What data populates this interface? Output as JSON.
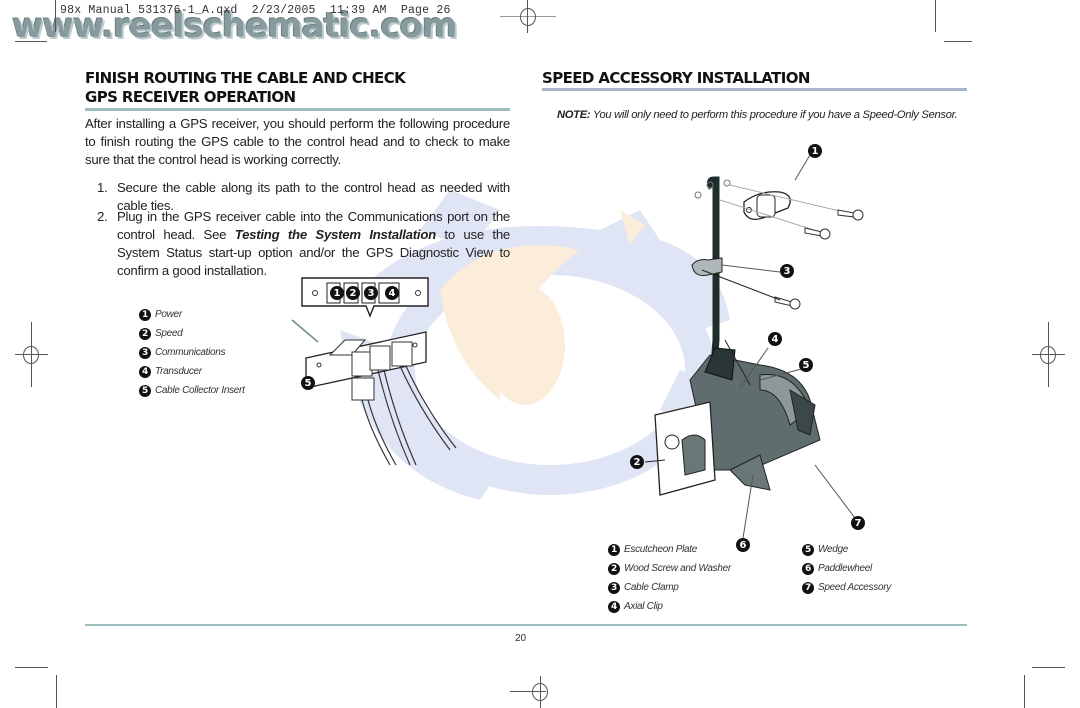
{
  "slug": "98x Manual 531376-1_A.qxd  2/23/2005  11:39 AM  Page 26",
  "watermark": "www.reelschematic.com",
  "left": {
    "heading_line1": "FINISH ROUTING THE CABLE AND CHECK",
    "heading_line2": "GPS RECEIVER OPERATION",
    "intro": "After installing a GPS receiver, you should perform the following procedure to finish routing the GPS cable to the control head and to check to make sure that the control head is working correctly.",
    "steps": [
      {
        "num": "1.",
        "text": "Secure the cable along its path to the control head as needed with cable ties."
      },
      {
        "num": "2.",
        "text_before": "Plug in the GPS receiver cable into the Communications port on the control head. See ",
        "emphasis": "Testing the System Installation",
        "text_after": " to use the System Status start-up option and/or the GPS Diagnostic View to confirm a good installation."
      }
    ],
    "figure_legend": [
      {
        "num": "1",
        "label": "Power"
      },
      {
        "num": "2",
        "label": "Speed"
      },
      {
        "num": "3",
        "label": "Communications"
      },
      {
        "num": "4",
        "label": "Transducer"
      },
      {
        "num": "5",
        "label": "Cable Collector Insert"
      }
    ],
    "port_numbers": [
      "1",
      "2",
      "3",
      "4"
    ],
    "callout_5": "5"
  },
  "right": {
    "heading": "SPEED ACCESSORY INSTALLATION",
    "note_label": "NOTE:",
    "note_text": " You will only need to perform this procedure if you have a Speed-Only Sensor.",
    "callouts": [
      "1",
      "2",
      "3",
      "4",
      "5",
      "6",
      "7"
    ],
    "legend_col1": [
      {
        "num": "1",
        "label": "Escutcheon Plate"
      },
      {
        "num": "2",
        "label": "Wood Screw and Washer"
      },
      {
        "num": "3",
        "label": "Cable Clamp"
      },
      {
        "num": "4",
        "label": "Axial Clip"
      }
    ],
    "legend_col2": [
      {
        "num": "5",
        "label": "Wedge"
      },
      {
        "num": "6",
        "label": "Paddlewheel"
      },
      {
        "num": "7",
        "label": "Speed Accessory"
      }
    ]
  },
  "page_number": "20",
  "colors": {
    "teal_rule": "#9fbcbc",
    "blue_rule": "#a8b4c8",
    "watermark_blue": "#c9d3ef",
    "watermark_orange": "#f8dcb8"
  }
}
